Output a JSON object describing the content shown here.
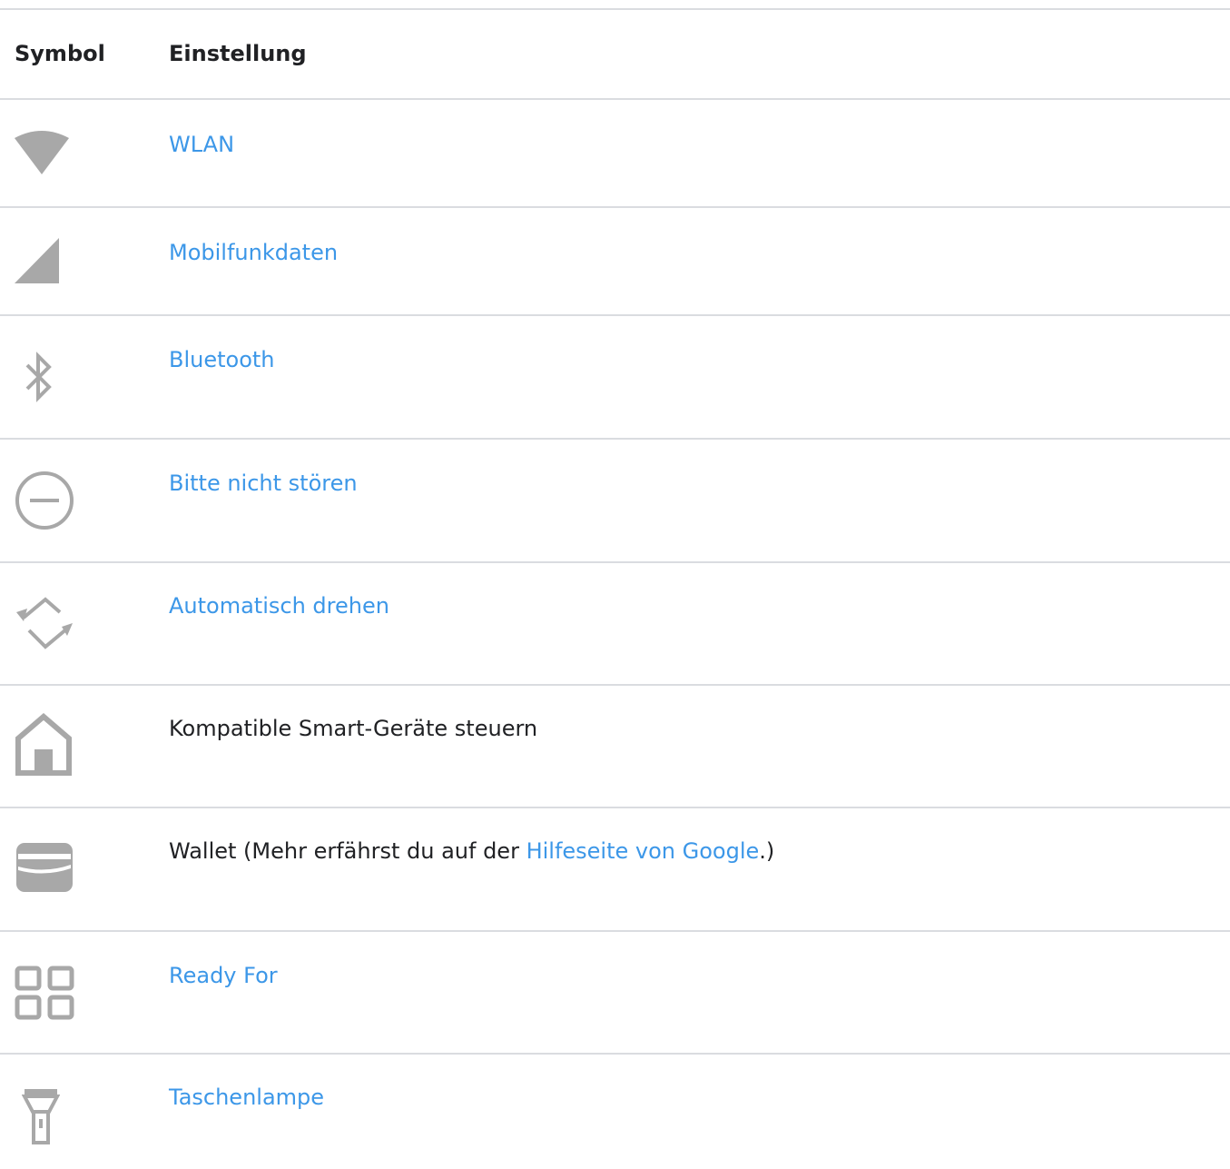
{
  "table": {
    "header": {
      "symbol": "Symbol",
      "setting": "Einstellung"
    },
    "rows": [
      {
        "icon": "wifi-icon",
        "label": "WLAN"
      },
      {
        "icon": "cellular-signal-icon",
        "label": "Mobilfunkdaten"
      },
      {
        "icon": "bluetooth-icon",
        "label": "Bluetooth"
      },
      {
        "icon": "do-not-disturb-icon",
        "label": "Bitte nicht stören"
      },
      {
        "icon": "auto-rotate-icon",
        "label": "Automatisch drehen"
      },
      {
        "icon": "home-icon",
        "label": "Kompatible Smart-Geräte steuern"
      },
      {
        "icon": "wallet-icon",
        "label_prefix": "Wallet (Mehr erfährst du auf der ",
        "link": "Hilfeseite von Google",
        "label_suffix": ".)"
      },
      {
        "icon": "ready-for-icon",
        "label": "Ready For"
      },
      {
        "icon": "flashlight-icon",
        "label": "Taschenlampe"
      }
    ]
  },
  "colors": {
    "link": "#3c97e8",
    "icon": "#a8a8a8",
    "divider": "#dadce0"
  }
}
